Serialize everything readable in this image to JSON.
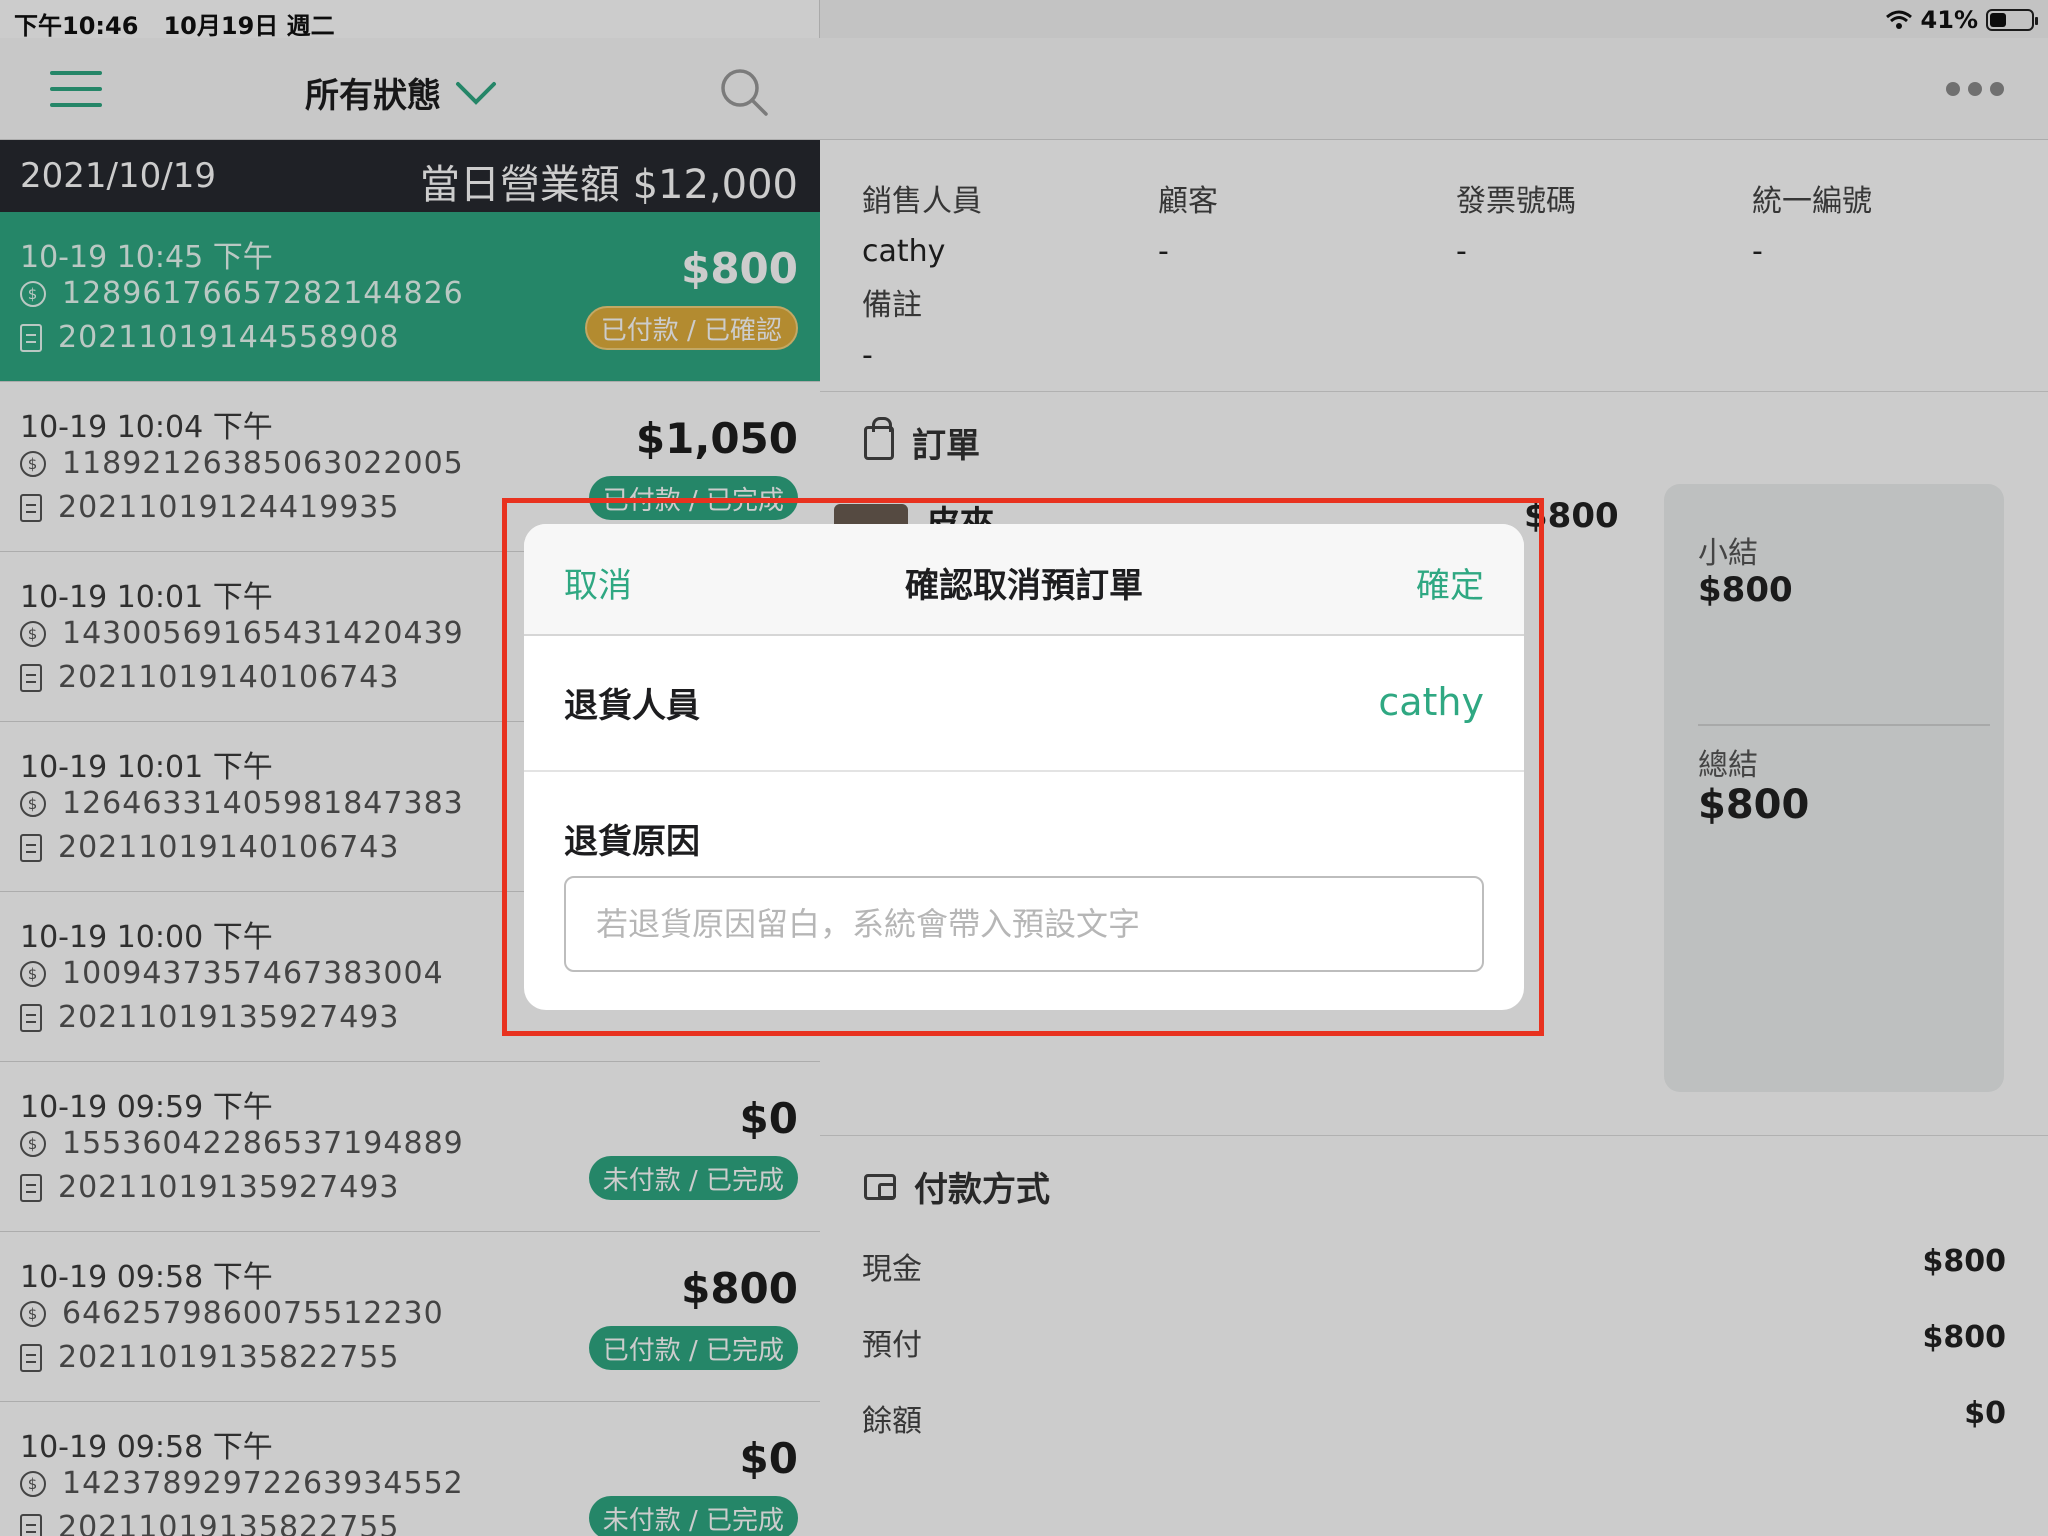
{
  "status_bar": {
    "time": "下午10:46",
    "date": "10月19日 週二",
    "battery": "41%",
    "battery_level": 0.41
  },
  "left_nav": {
    "title": "所有狀態"
  },
  "day_header": {
    "date": "2021/10/19",
    "revenue": "當日營業額 $12,000"
  },
  "orders": [
    {
      "time": "10-19 10:45 下午",
      "payment_no": "12896176657282144826",
      "receipt_no": "20211019144558908",
      "amount": "$800",
      "status": "已付款 / 已確認"
    },
    {
      "time": "10-19 10:04 下午",
      "payment_no": "11892126385063022005",
      "receipt_no": "20211019124419935",
      "amount": "$1,050",
      "status": "已付款 / 已完成"
    },
    {
      "time": "10-19 10:01 下午",
      "payment_no": "14300569165431420439",
      "receipt_no": "20211019140106743",
      "amount": "",
      "status": ""
    },
    {
      "time": "10-19 10:01 下午",
      "payment_no": "12646331405981847383",
      "receipt_no": "20211019140106743",
      "amount": "",
      "status": ""
    },
    {
      "time": "10-19 10:00 下午",
      "payment_no": "10094373574673830​04",
      "receipt_no": "20211019135927493",
      "amount": "",
      "status": ""
    },
    {
      "time": "10-19 09:59 下午",
      "payment_no": "15536042286537194889",
      "receipt_no": "20211019135927493",
      "amount": "$0",
      "status": "未付款 / 已完成"
    },
    {
      "time": "10-19 09:58 下午",
      "payment_no": "6462579860075512230",
      "receipt_no": "20211019135822755",
      "amount": "$800",
      "status": "已付款 / 已完成"
    },
    {
      "time": "10-19 09:58 下午",
      "payment_no": "14237892972263934552",
      "receipt_no": "20211019135822755",
      "amount": "$0",
      "status": "未付款 / 已完成"
    }
  ],
  "detail": {
    "info": [
      {
        "label": "銷售人員",
        "value": "cathy"
      },
      {
        "label": "顧客",
        "value": "-"
      },
      {
        "label": "發票號碼",
        "value": "-"
      },
      {
        "label": "統一編號",
        "value": "-"
      }
    ],
    "note": {
      "label": "備註",
      "value": "-"
    },
    "order_section_title": "訂單",
    "item": {
      "name": "皮夾",
      "price": "$800"
    },
    "summary": {
      "subtotal_label": "小結",
      "subtotal": "$800",
      "total_label": "總結",
      "total": "$800"
    },
    "payment_section_title": "付款方式",
    "payments": [
      {
        "label": "現金",
        "value": "$800"
      },
      {
        "label": "預付",
        "value": "$800"
      },
      {
        "label": "餘額",
        "value": "$0"
      }
    ]
  },
  "modal": {
    "cancel_label": "取消",
    "title": "確認取消預訂單",
    "confirm_label": "確定",
    "staff_label": "退貨人員",
    "staff_value": "cathy",
    "reason_label": "退貨原因",
    "reason_placeholder": "若退貨原因留白，系統會帶入預設文字"
  },
  "colors": {
    "accent": "#2fa882",
    "badge_pending": "#e0ae3d",
    "highlight": "#e8321f",
    "day_header_bg": "#272a30"
  },
  "icons": [
    "menu-icon",
    "chevron-down-icon",
    "search-icon",
    "more-icon",
    "coin-icon",
    "receipt-icon",
    "bag-icon",
    "wallet-icon",
    "wifi-icon",
    "battery-icon"
  ]
}
